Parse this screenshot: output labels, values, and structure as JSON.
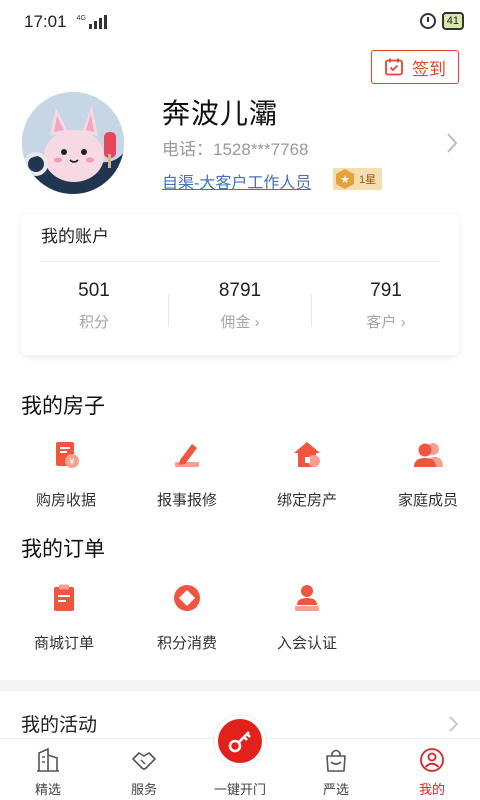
{
  "status_bar": {
    "time": "17:01",
    "network": "4G",
    "battery": "41"
  },
  "checkin": {
    "label": "签到"
  },
  "profile": {
    "name": "奔波儿灞",
    "phone": "电话：1528***7768",
    "role": "自渠-大客户工作人员",
    "level": "1星"
  },
  "account": {
    "title": "我的账户",
    "stats": [
      {
        "value": "501",
        "label": "积分"
      },
      {
        "value": "8791",
        "label": "佣金 ›"
      },
      {
        "value": "791",
        "label": "客户 ›"
      }
    ]
  },
  "house": {
    "title": "我的房子",
    "items": [
      {
        "label": "购房收据",
        "icon": "receipt-icon"
      },
      {
        "label": "报事报修",
        "icon": "repair-pencil-icon"
      },
      {
        "label": "绑定房产",
        "icon": "house-bind-icon"
      },
      {
        "label": "家庭成员",
        "icon": "family-members-icon"
      }
    ]
  },
  "orders": {
    "title": "我的订单",
    "items": [
      {
        "label": "商城订单",
        "icon": "mall-order-icon"
      },
      {
        "label": "积分消费",
        "icon": "points-icon"
      },
      {
        "label": "入会认证",
        "icon": "member-auth-icon"
      }
    ]
  },
  "activity": {
    "title": "我的活动"
  },
  "nav": {
    "items": [
      {
        "label": "精选",
        "icon": "building-icon"
      },
      {
        "label": "服务",
        "icon": "handshake-icon"
      },
      {
        "label": "一键开门",
        "icon": "key-icon"
      },
      {
        "label": "严选",
        "icon": "shop-icon"
      },
      {
        "label": "我的",
        "icon": "user-icon"
      }
    ]
  },
  "colors": {
    "accent": "#e8432f",
    "link": "#4a70b5",
    "nav_active": "#d8232a"
  }
}
